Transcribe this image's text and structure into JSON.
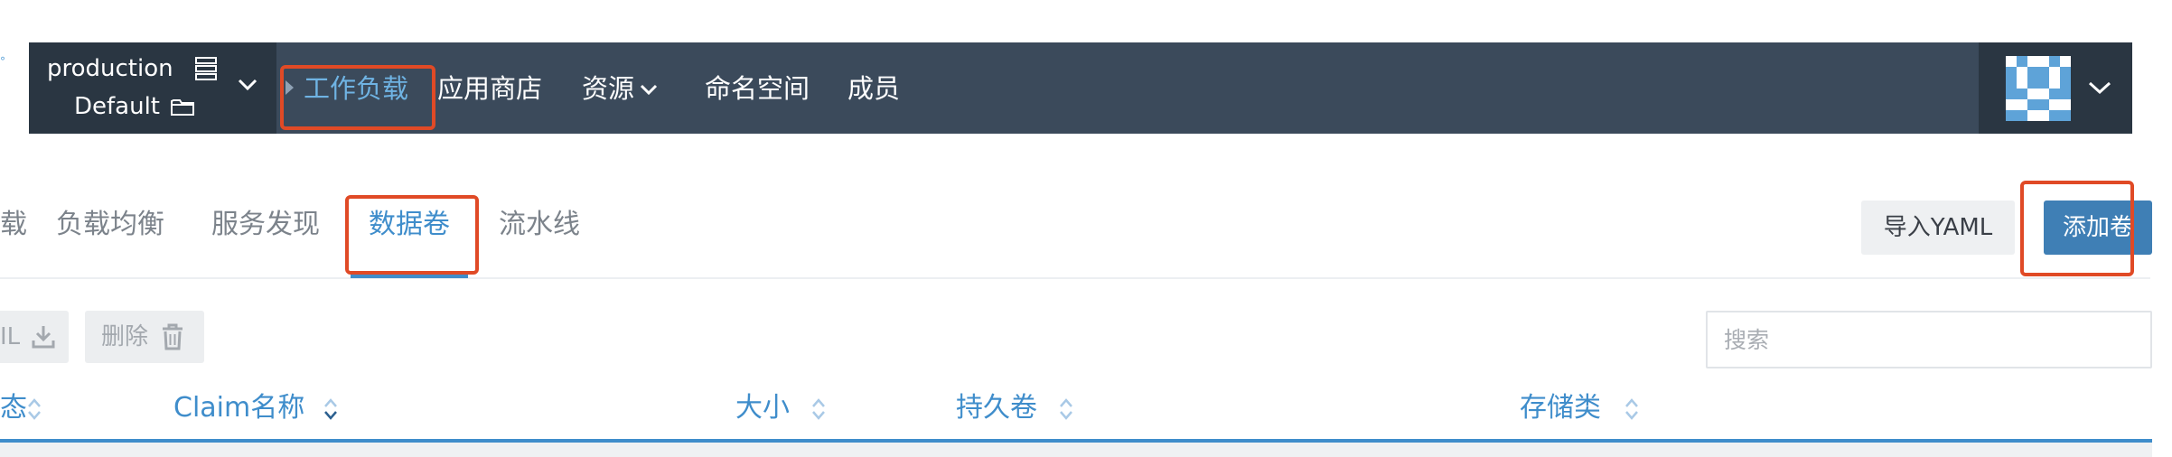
{
  "colors": {
    "nav_bg": "#3b4a5b",
    "nav_dark": "#2a3642",
    "accent": "#3f8dcb",
    "primary_button": "#3f7fb5",
    "highlight": "#e04a26"
  },
  "header": {
    "cluster_name": "production",
    "project_name": "Default",
    "nav": [
      "工作负载",
      "应用商店",
      "资源",
      "命名空间",
      "成员"
    ],
    "active_nav": "工作负载",
    "icons": [
      "server-icon",
      "folder-icon",
      "chevron-down-icon",
      "avatar",
      "chevron-down-icon"
    ]
  },
  "tabs": {
    "items": [
      "载",
      "负载均衡",
      "服务发现",
      "数据卷",
      "流水线"
    ],
    "active": "数据卷"
  },
  "actions": {
    "import_yaml": "导入YAML",
    "add_volume": "添加卷"
  },
  "toolbar": {
    "yaml_partial": "IL",
    "delete": "删除",
    "search_placeholder": "搜索"
  },
  "table": {
    "columns": [
      "态",
      "Claim名称",
      "大小",
      "持久卷",
      "存储类"
    ]
  }
}
